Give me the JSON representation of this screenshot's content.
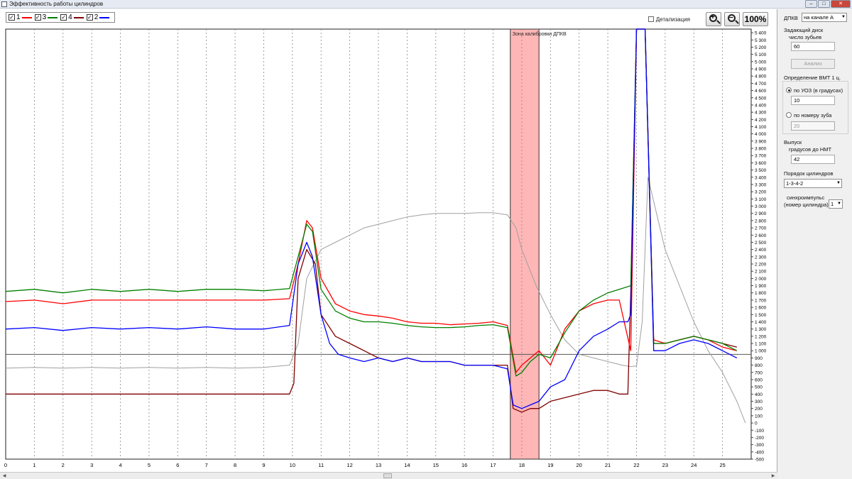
{
  "window": {
    "title": "Эффективность работы цилиндров"
  },
  "toolbar": {
    "detail_label": "Детализация",
    "zoom_100_label": "100%"
  },
  "legend": [
    {
      "label": "1",
      "color": "#ff0000",
      "checked": true
    },
    {
      "label": "3",
      "color": "#008000",
      "checked": true
    },
    {
      "label": "4",
      "color": "#800000",
      "checked": true
    },
    {
      "label": "2",
      "color": "#0000ff",
      "checked": true
    }
  ],
  "panel": {
    "dpkv_label": "ДПКВ",
    "dpkv_value": "на канале A",
    "disk_label": "Задающий диск",
    "teeth_label": "число зубьев",
    "teeth_value": "60",
    "analyze_button": "Анализ",
    "tdc_label": "Определение ВМТ 1 ц.",
    "by_advance_label": "по УОЗ (в градусах)",
    "by_advance_value": "10",
    "by_tooth_label": "по номеру зуба",
    "by_tooth_value": "20",
    "exhaust_label": "Выпуск",
    "exhaust_sub_label": "градусов до НМТ",
    "exhaust_value": "42",
    "order_label": "Порядок цилиндров",
    "order_value": "1-3-4-2",
    "sync_label_1": "синхроимпульс",
    "sync_label_2": "(номер цилиндра)",
    "sync_value": "1"
  },
  "chart_data": {
    "type": "line",
    "xlim": [
      0,
      26
    ],
    "ylim": [
      -500,
      5450
    ],
    "x_ticks": [
      0,
      1,
      2,
      3,
      4,
      5,
      6,
      7,
      8,
      9,
      10,
      11,
      12,
      13,
      14,
      15,
      16,
      17,
      18,
      19,
      20,
      21,
      22,
      23,
      24,
      25
    ],
    "y_ticks": [
      -500,
      -400,
      -300,
      -200,
      -100,
      0,
      100,
      200,
      300,
      400,
      500,
      600,
      700,
      800,
      900,
      1000,
      1100,
      1200,
      1300,
      1400,
      1500,
      1600,
      1700,
      1800,
      1900,
      2000,
      2100,
      2200,
      2300,
      2400,
      2500,
      2600,
      2700,
      2800,
      2900,
      3000,
      3100,
      3200,
      3300,
      3400,
      3500,
      3600,
      3700,
      3800,
      3900,
      4000,
      4100,
      4200,
      4300,
      4400,
      4500,
      4600,
      4700,
      4800,
      4900,
      5000,
      5100,
      5200,
      5300,
      5400
    ],
    "horizontal_line": 950,
    "calibration_zone": {
      "label": "Зона калибровки ДПКВ",
      "x_start": 17.6,
      "x_end": 18.6,
      "color": "#ffb6b6"
    },
    "grid": "vertical dotted",
    "series": [
      {
        "name": "1",
        "color": "#ff0000",
        "x": [
          0,
          1,
          2,
          3,
          4,
          5,
          6,
          7,
          8,
          9,
          9.9,
          10.2,
          10.5,
          10.7,
          11,
          11.5,
          12,
          12.5,
          13,
          13.5,
          14,
          14.5,
          15,
          15.5,
          16,
          16.5,
          17,
          17.5,
          17.8,
          18,
          18.3,
          18.6,
          19,
          19.5,
          20,
          20.5,
          21,
          21.4,
          21.8,
          22,
          22.3,
          22.6,
          23,
          23.5,
          24,
          24.5,
          25,
          25.5
        ],
        "y": [
          1680,
          1700,
          1650,
          1700,
          1700,
          1700,
          1700,
          1700,
          1700,
          1700,
          1720,
          2200,
          2800,
          2700,
          2000,
          1650,
          1550,
          1500,
          1480,
          1450,
          1400,
          1380,
          1380,
          1360,
          1370,
          1380,
          1400,
          1350,
          700,
          800,
          900,
          1000,
          800,
          1300,
          1550,
          1650,
          1700,
          1700,
          1000,
          5450,
          5450,
          1150,
          1100,
          1150,
          1200,
          1150,
          1050,
          1000
        ]
      },
      {
        "name": "3",
        "color": "#008000",
        "x": [
          0,
          1,
          2,
          3,
          4,
          5,
          6,
          7,
          8,
          9,
          9.9,
          10.2,
          10.5,
          10.7,
          11,
          11.5,
          12,
          12.5,
          13,
          13.5,
          14,
          14.5,
          15,
          15.5,
          16,
          16.5,
          17,
          17.5,
          17.8,
          18,
          18.3,
          18.6,
          19,
          19.5,
          20,
          20.5,
          21,
          21.4,
          21.8,
          22,
          22.3,
          22.6,
          23,
          23.5,
          24,
          24.5,
          25,
          25.5
        ],
        "y": [
          1820,
          1850,
          1800,
          1850,
          1820,
          1850,
          1820,
          1850,
          1850,
          1830,
          1860,
          2300,
          2750,
          2650,
          1850,
          1550,
          1450,
          1400,
          1400,
          1380,
          1350,
          1330,
          1320,
          1320,
          1330,
          1350,
          1360,
          1320,
          650,
          700,
          850,
          950,
          900,
          1250,
          1550,
          1700,
          1800,
          1850,
          1900,
          5450,
          5450,
          1100,
          1100,
          1150,
          1200,
          1150,
          1100,
          1000
        ]
      },
      {
        "name": "4",
        "color": "#800000",
        "x": [
          0,
          1,
          2,
          3,
          4,
          5,
          6,
          7,
          8,
          9,
          9.9,
          10.05,
          10.2,
          10.5,
          10.8,
          11,
          11.5,
          12,
          12.5,
          13,
          13.5,
          14,
          14.5,
          15,
          15.5,
          16,
          16.5,
          17,
          17.5,
          17.7,
          18,
          18.3,
          18.6,
          19,
          19.5,
          20,
          20.5,
          21,
          21.4,
          21.7,
          21.8,
          22,
          22.3,
          22.6,
          23,
          23.5,
          24,
          24.5,
          25,
          25.5
        ],
        "y": [
          400,
          400,
          400,
          400,
          400,
          400,
          400,
          400,
          400,
          400,
          400,
          550,
          2000,
          2400,
          2200,
          1500,
          1200,
          1100,
          1000,
          900,
          850,
          900,
          850,
          850,
          850,
          800,
          800,
          800,
          800,
          200,
          150,
          200,
          200,
          300,
          350,
          400,
          450,
          450,
          400,
          400,
          1800,
          5450,
          5450,
          1100,
          1100,
          1150,
          1200,
          1150,
          1100,
          1050
        ]
      },
      {
        "name": "2",
        "color": "#0000ff",
        "x": [
          0,
          1,
          2,
          3,
          4,
          5,
          6,
          7,
          8,
          9,
          9.9,
          10.2,
          10.5,
          10.7,
          11,
          11.3,
          11.6,
          12,
          12.5,
          13,
          13.5,
          14,
          14.5,
          15,
          15.5,
          16,
          16.5,
          17,
          17.5,
          17.7,
          18,
          18.3,
          18.6,
          19,
          19.5,
          20,
          20.5,
          21,
          21.4,
          21.7,
          21.8,
          22,
          22.3,
          22.6,
          23,
          23.5,
          24,
          24.5,
          25,
          25.5
        ],
        "y": [
          1300,
          1320,
          1280,
          1320,
          1300,
          1320,
          1300,
          1330,
          1300,
          1300,
          1350,
          2200,
          2500,
          2300,
          1500,
          1100,
          950,
          900,
          850,
          900,
          850,
          900,
          850,
          850,
          850,
          800,
          800,
          800,
          750,
          250,
          200,
          250,
          300,
          500,
          600,
          1000,
          1200,
          1300,
          1400,
          1400,
          1500,
          5450,
          5450,
          1000,
          1000,
          1100,
          1150,
          1100,
          1000,
          900
        ]
      },
      {
        "name": "",
        "color": "#a0a0a0",
        "x": [
          0,
          1,
          2,
          3,
          4,
          5,
          6,
          7,
          8,
          9,
          9.9,
          10.2,
          10.5,
          11,
          11.5,
          12,
          12.5,
          13,
          13.5,
          14,
          14.5,
          15,
          15.5,
          16,
          16.5,
          17,
          17.5,
          17.8,
          18,
          18.5,
          19,
          19.5,
          20,
          20.5,
          21,
          21.5,
          21.8,
          22,
          22.2,
          22.4,
          22.7,
          23,
          23.5,
          24,
          24.5,
          25,
          25.5,
          25.8
        ],
        "y": [
          760,
          770,
          760,
          770,
          760,
          770,
          760,
          770,
          760,
          770,
          800,
          1100,
          2000,
          2400,
          2500,
          2600,
          2700,
          2750,
          2800,
          2850,
          2880,
          2900,
          2900,
          2900,
          2910,
          2910,
          2880,
          2700,
          2400,
          1900,
          1500,
          1150,
          950,
          900,
          850,
          800,
          780,
          790,
          1400,
          3400,
          2900,
          2400,
          1900,
          1400,
          1000,
          700,
          300,
          0
        ]
      }
    ]
  }
}
